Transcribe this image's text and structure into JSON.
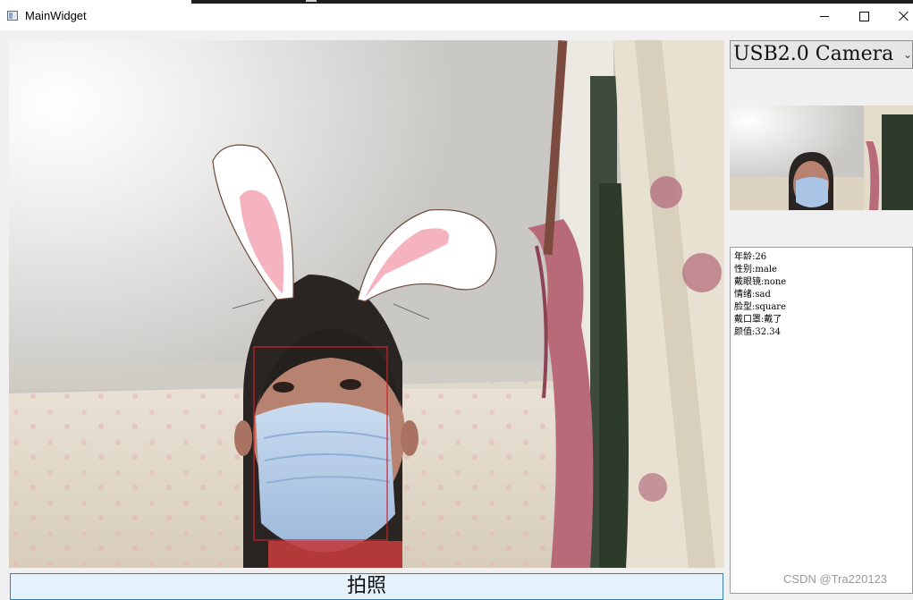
{
  "window": {
    "title": "MainWidget",
    "controls": [
      "minimize-icon",
      "maximize-icon",
      "close-icon"
    ]
  },
  "camera": {
    "selected": "USB2.0 Camera"
  },
  "video": {
    "overlay": "bunny-ears"
  },
  "attributes": [
    {
      "label": "年龄",
      "value": "26"
    },
    {
      "label": "性别",
      "value": "male"
    },
    {
      "label": "戴眼镜",
      "value": "none"
    },
    {
      "label": "情绪",
      "value": "sad"
    },
    {
      "label": "脸型",
      "value": "square"
    },
    {
      "label": "戴口罩",
      "value": "戴了"
    },
    {
      "label": "颜值",
      "value": "32.34"
    }
  ],
  "actions": {
    "capture_label": "拍照"
  },
  "watermark": "CSDN @Tra220123",
  "colors": {
    "face_box": "#d0202a",
    "button_bg": "#e5f1fb",
    "button_border": "#3c7fb1"
  }
}
